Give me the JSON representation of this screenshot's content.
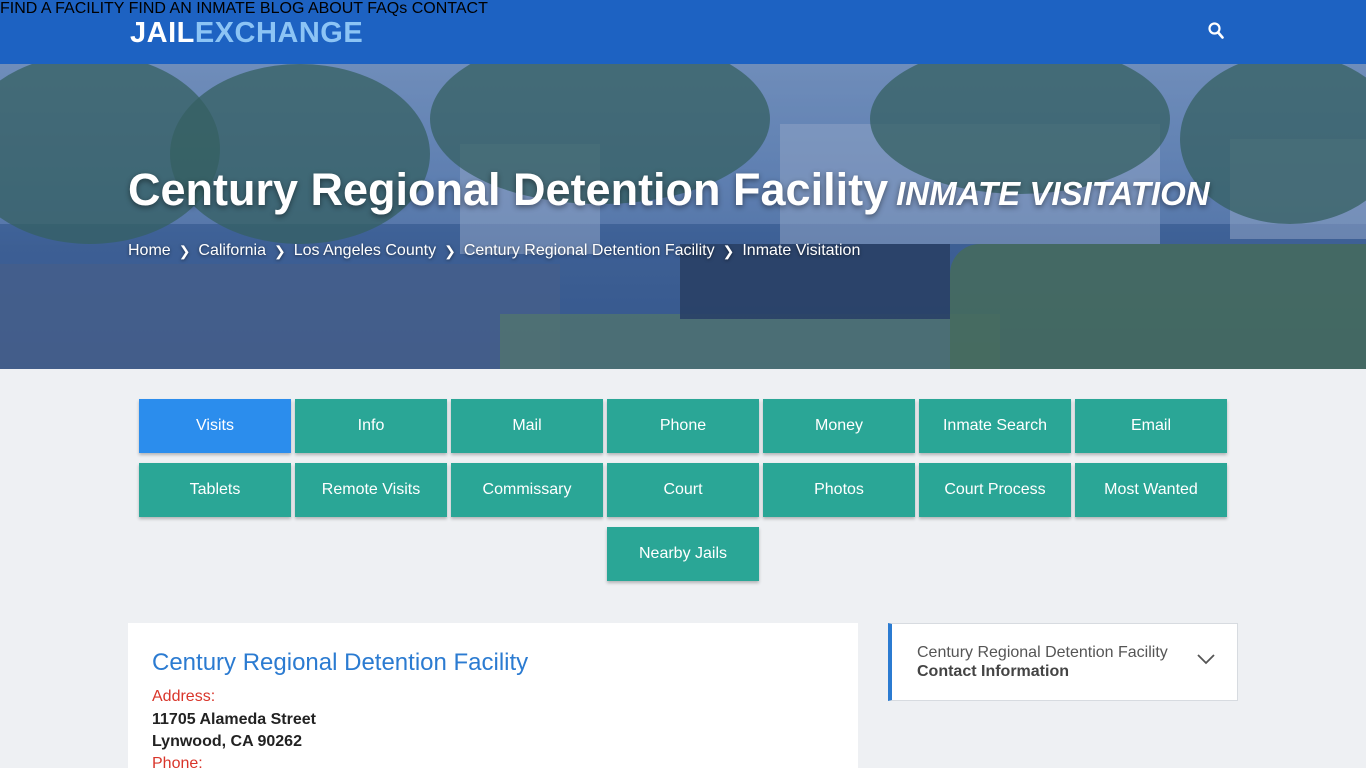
{
  "header": {
    "logo_part1": "JAIL",
    "logo_part2": "EXCHANGE",
    "nav": [
      {
        "label": "FIND A FACILITY"
      },
      {
        "label": "FIND AN INMATE"
      },
      {
        "label": "BLOG"
      },
      {
        "label": "ABOUT"
      },
      {
        "label": "FAQs"
      },
      {
        "label": "CONTACT"
      }
    ],
    "search_icon": "search-icon"
  },
  "hero": {
    "title": "Century Regional Detention Facility",
    "subtitle": "INMATE VISITATION",
    "breadcrumbs": [
      "Home",
      "California",
      "Los Angeles County",
      "Century Regional Detention Facility",
      "Inmate Visitation"
    ]
  },
  "tabs": {
    "row1": [
      "Visits",
      "Info",
      "Mail",
      "Phone",
      "Money",
      "Inmate Search",
      "Email"
    ],
    "row2": [
      "Tablets",
      "Remote Visits",
      "Commissary",
      "Court",
      "Photos",
      "Court Process",
      "Most Wanted"
    ],
    "row3": [
      "Nearby Jails"
    ],
    "active": "Visits",
    "colors": {
      "active": "#2b8ded",
      "default": "#2aa696"
    }
  },
  "facility_card": {
    "title": "Century Regional Detention Facility",
    "address_label": "Address:",
    "address_line1": "11705 Alameda Street",
    "address_line2": "Lynwood, CA 90262",
    "phone_label": "Phone:"
  },
  "contact_panel": {
    "line1": "Century Regional Detention Facility",
    "line2": "Contact Information",
    "icon": "chevron-down-icon"
  },
  "colors": {
    "header_bg": "#1d62c2",
    "accent_blue": "#2b7bd1",
    "label_red": "#d9352a",
    "page_bg": "#eef0f3"
  }
}
